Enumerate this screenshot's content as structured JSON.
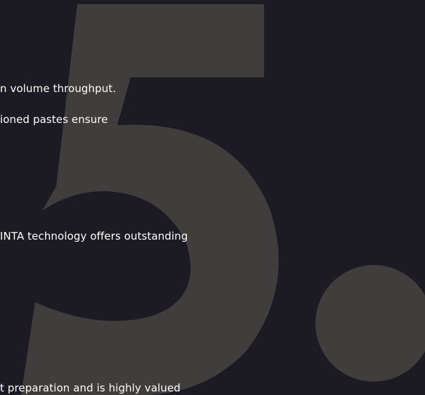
{
  "decoration": {
    "big_number": "5.",
    "number_color": "#3f3e3c",
    "background_color": "#1c1b23",
    "text_color": "#ffffff"
  },
  "text_lines": [
    "n volume throughput.",
    "ioned pastes ensure",
    "INTA technology offers outstanding",
    "t preparation and is highly valued"
  ]
}
